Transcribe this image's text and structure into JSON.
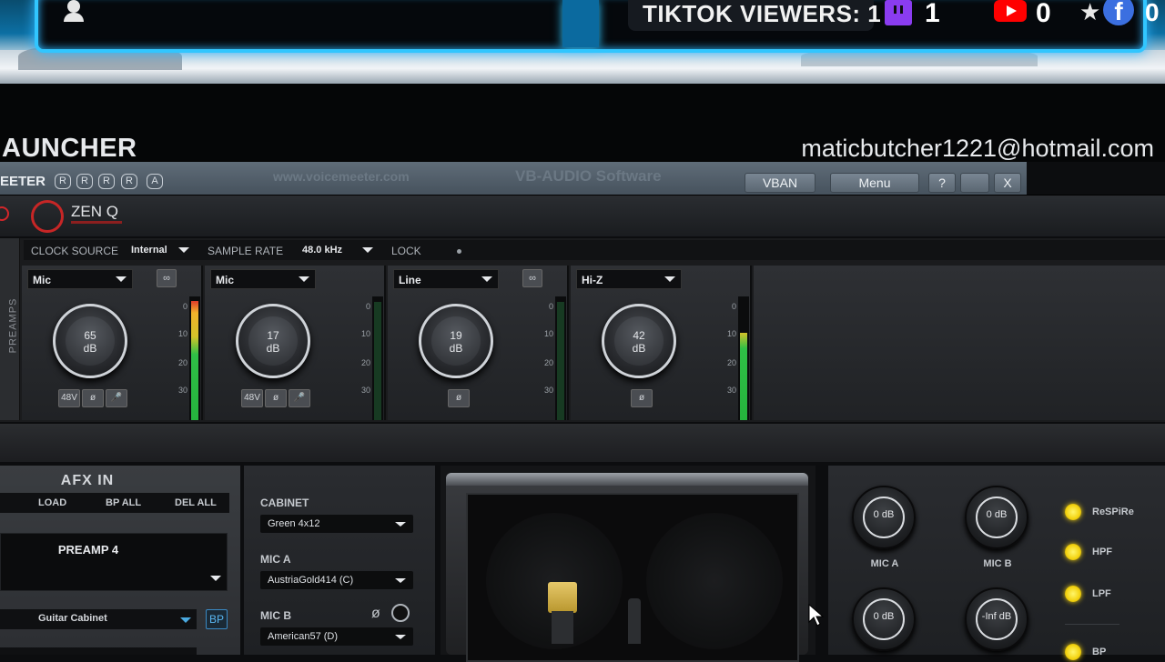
{
  "overlay": {
    "viewers_label": "TIKTOK VIEWERS: 1",
    "twitch_count": "1",
    "youtube_count": "0",
    "facebook_count": "0",
    "neon_color": "#31c6ff"
  },
  "launcher": {
    "title": "AUNCHER",
    "email": "maticbutcher1221@hotmail.com"
  },
  "voicemeeter": {
    "title": "EETER",
    "r_buttons": [
      "R",
      "R",
      "R",
      "R",
      "A"
    ],
    "watermark_site": "www.voicemeeter.com",
    "watermark_company": "VB-AUDIO Software",
    "vban_label": "VBAN",
    "menu_label": "Menu",
    "help_label": "?",
    "close_label": "X"
  },
  "zenq": {
    "name": "ZEN Q",
    "brand_color": "#c72626"
  },
  "preamp": {
    "tab_label": "PREAMPS",
    "clock_source_label": "CLOCK SOURCE",
    "clock_source_value": "Internal",
    "sample_rate_label": "SAMPLE RATE",
    "sample_rate_value": "48.0 kHz",
    "lock_label": "LOCK",
    "scale": [
      "0",
      "10",
      "20",
      "30"
    ],
    "channels": [
      {
        "input": "Mic",
        "gain": "65",
        "unit": "dB",
        "buttons": [
          "48V",
          "ø",
          "mic"
        ],
        "meter_level": 0.98
      },
      {
        "input": "Mic",
        "gain": "17",
        "unit": "dB",
        "buttons": [
          "48V",
          "ø",
          "mic"
        ],
        "meter_level": 0.0
      },
      {
        "input": "Line",
        "gain": "19",
        "unit": "dB",
        "buttons": [
          "ø"
        ],
        "meter_level": 0.0
      },
      {
        "input": "Hi-Z",
        "gain": "42",
        "unit": "dB",
        "buttons": [
          "ø"
        ],
        "meter_level": 0.7
      }
    ]
  },
  "afx": {
    "title": "AFX IN",
    "load_label": "LOAD",
    "bp_all_label": "BP ALL",
    "del_all_label": "DEL ALL",
    "preset_label": "PREAMP 4",
    "module_label": "Guitar Cabinet",
    "bp_label": "BP"
  },
  "cabinet": {
    "cabinet_label": "CABINET",
    "cabinet_value": "Green 4x12",
    "mic_a_label": "MIC A",
    "mic_a_value": "AustriaGold414 (C)",
    "mic_b_label": "MIC B",
    "mic_b_value": "American57 (D)",
    "phase_symbol": "ø"
  },
  "mics": {
    "knobs": [
      {
        "value": "0 dB",
        "label": "MIC A"
      },
      {
        "value": "0 dB",
        "label": "MIC B"
      },
      {
        "value": "0 dB",
        "label": ""
      },
      {
        "value": "-Inf dB",
        "label": ""
      }
    ],
    "toggles": [
      "ReSPiRe",
      "HPF",
      "LPF",
      "BP"
    ]
  }
}
